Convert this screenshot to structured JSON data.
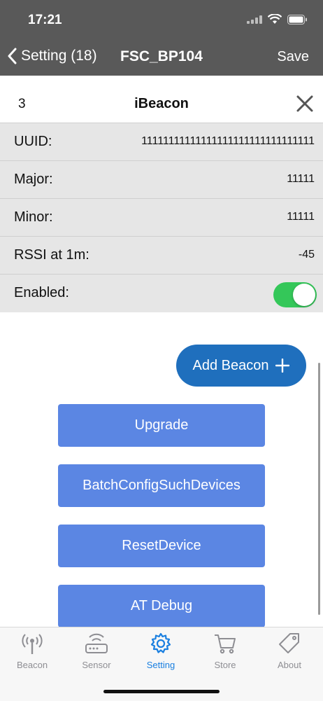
{
  "status": {
    "time": "17:21"
  },
  "nav": {
    "back_label": "Setting (18)",
    "title": "FSC_BP104",
    "save_label": "Save"
  },
  "beacon": {
    "index": "3",
    "title": "iBeacon"
  },
  "fields": [
    {
      "label": "UUID:",
      "value": "11111111111111111111111111111111"
    },
    {
      "label": "Major:",
      "value": "11111"
    },
    {
      "label": "Minor:",
      "value": "11111"
    },
    {
      "label": "RSSI at 1m:",
      "value": "-45"
    }
  ],
  "enabled": {
    "label": "Enabled:",
    "on": true
  },
  "add_beacon": {
    "label": "Add Beacon",
    "icon": "plus-icon"
  },
  "actions": [
    {
      "label": "Upgrade"
    },
    {
      "label": "BatchConfigSuchDevices"
    },
    {
      "label": "ResetDevice"
    },
    {
      "label": "AT Debug"
    }
  ],
  "tabs": [
    {
      "label": "Beacon",
      "icon": "antenna-icon",
      "active": false
    },
    {
      "label": "Sensor",
      "icon": "router-icon",
      "active": false
    },
    {
      "label": "Setting",
      "icon": "gear-icon",
      "active": true
    },
    {
      "label": "Store",
      "icon": "cart-icon",
      "active": false
    },
    {
      "label": "About",
      "icon": "tag-icon",
      "active": false
    }
  ],
  "colors": {
    "header": "#595959",
    "accent": "#1a7fe0",
    "button": "#5b86e3",
    "add_button": "#1f6fbd",
    "toggle_on": "#34c759"
  }
}
